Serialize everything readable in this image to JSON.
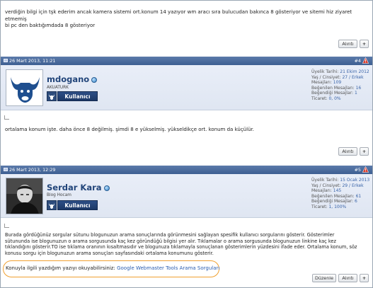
{
  "prev_post": {
    "text_line1": "verdiğin bilgi için tşk ederim ancak kamera sistemi ort.konum 14 yazıyor wm aracı sıra bulucudan bakınca 8 gösteriyor ve sitemi hiz ziyaret etmemiş",
    "text_line2": "bi pc den baktığımdada 8 gösteriyor",
    "quote_label": "Alıntı",
    "plus_label": "+"
  },
  "post4": {
    "date": "26 Mart 2013, 11:21",
    "number": "#4",
    "username": "mdogano",
    "user_title": "AKUATURK",
    "rank": "Kullanıcı",
    "stats": [
      {
        "label": "Üyelik Tarihi:",
        "value": "21 Ekim 2012"
      },
      {
        "label": "Yaş / Cinsiyet:",
        "value": "27 / Erkek"
      },
      {
        "label": "Mesajları:",
        "value": "109"
      },
      {
        "label": "Beğenilen Mesajları:",
        "value": "16"
      },
      {
        "label": "Beğendiği Mesajlar:",
        "value": "1"
      },
      {
        "label": "Ticaret:",
        "value": "0, 0%"
      }
    ],
    "text": "ortalama konum işte. daha önce 8 değilmiş. şimdi 8 e yükselmiş. yükseldikçe ort. konum da küçülür.",
    "quote_label": "Alıntı",
    "plus_label": "+"
  },
  "post5": {
    "date": "26 Mart 2013, 12:29",
    "number": "#5",
    "username": "Serdar Kara",
    "user_title": "Blog Hocam",
    "rank": "Kullanıcı",
    "stats": [
      {
        "label": "Üyelik Tarihi:",
        "value": "15 Ocak 2013"
      },
      {
        "label": "Yaş / Cinsiyet:",
        "value": "29 / Erkek"
      },
      {
        "label": "Mesajları:",
        "value": "145"
      },
      {
        "label": "Beğenilen Mesajları:",
        "value": "61"
      },
      {
        "label": "Beğendiği Mesajlar:",
        "value": "6"
      },
      {
        "label": "Ticaret:",
        "value": "1, 100%"
      }
    ],
    "text_lines": [
      "Burada gördüğünüz sorgular sütunu blogunuzun arama sonuçlarında görünmesini sağlayan spesifik kullanıcı sorgularını gösterir. Gösterimler",
      "sütununda ise blogunuzun o arama sorgusunda kaç kez göründüğü bilgisi yer alır. Tıklamalar o arama sorgusunda blogunuzun linkine kaç kez",
      "tıklandığını gösterir.TO ise tıklama oranının kısaltmasıdır ve blogunuza tıklamayla sonuçlanan gösterimlerin yüzdesini ifade eder. Ortalama konum, söz",
      "konusu sorgu için blogunuzun arama sonuçları sayfasındaki ortalama konumunu gösterir."
    ],
    "signature_text": "Konuyla ilgili yazdığım yazıyı okuyabilirsiniz:",
    "signature_link": "Google Webmaster Tools Arama Sorguları",
    "edit_label": "Düzenle",
    "quote_label": "Alıntı",
    "plus_label": "+"
  },
  "colors": {
    "header_bar": "#3d5f92",
    "link": "#2a5db0",
    "highlight": "#f0a030"
  }
}
